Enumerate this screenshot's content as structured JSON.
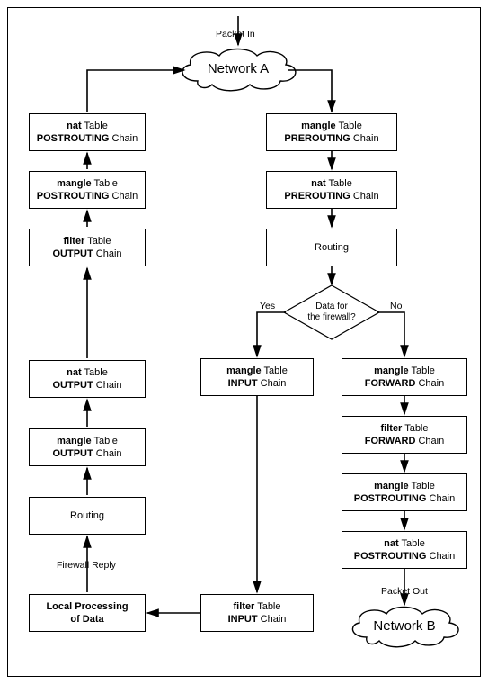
{
  "labels": {
    "packet_in": "Packet In",
    "packet_out": "Packet Out",
    "yes": "Yes",
    "no": "No",
    "firewall_reply": "Firewall Reply"
  },
  "clouds": {
    "network_a": "Network A",
    "network_b": "Network B"
  },
  "decision": {
    "line1": "Data for",
    "line2": "the firewall?"
  },
  "boxes": {
    "mangle_prerouting": {
      "l1": "<b>mangle</b> Table",
      "l2": "<b>PREROUTING</b> Chain"
    },
    "nat_prerouting": {
      "l1": "<b>nat</b> Table",
      "l2": "<b>PREROUTING</b> Chain"
    },
    "routing_r": {
      "l1": "Routing"
    },
    "mangle_input": {
      "l1": "<b>mangle</b> Table",
      "l2": "<b>INPUT</b> Chain"
    },
    "filter_input": {
      "l1": "<b>filter</b> Table",
      "l2": "<b>INPUT</b> Chain"
    },
    "mangle_forward": {
      "l1": "<b>mangle</b> Table",
      "l2": "<b>FORWARD</b> Chain"
    },
    "filter_forward": {
      "l1": "<b>filter</b> Table",
      "l2": "<b>FORWARD</b> Chain"
    },
    "mangle_postrouting_r": {
      "l1": "<b>mangle</b> Table",
      "l2": "<b>POSTROUTING</b> Chain"
    },
    "nat_postrouting_r": {
      "l1": "<b>nat</b> Table",
      "l2": "<b>POSTROUTING</b> Chain"
    },
    "local_processing": {
      "l1": "<b>Local Processing</b>",
      "l2": "<b>of Data</b>"
    },
    "routing_l": {
      "l1": "Routing"
    },
    "mangle_output": {
      "l1": "<b>mangle</b> Table",
      "l2": "<b>OUTPUT</b> Chain"
    },
    "nat_output": {
      "l1": "<b>nat</b> Table",
      "l2": "<b>OUTPUT</b> Chain"
    },
    "filter_output": {
      "l1": "<b>filter</b> Table",
      "l2": "<b>OUTPUT</b> Chain"
    },
    "mangle_postrouting_l": {
      "l1": "<b>mangle</b> Table",
      "l2": "<b>POSTROUTING</b> Chain"
    },
    "nat_postrouting_l": {
      "l1": "<b>nat</b> Table",
      "l2": "<b>POSTROUTING</b> Chain"
    }
  },
  "chart_data": {
    "type": "flowchart",
    "nodes": [
      {
        "id": "network_a",
        "type": "cloud",
        "label": "Network A"
      },
      {
        "id": "mangle_prerouting",
        "type": "process",
        "label": "mangle Table PREROUTING Chain"
      },
      {
        "id": "nat_prerouting",
        "type": "process",
        "label": "nat Table PREROUTING Chain"
      },
      {
        "id": "routing_r",
        "type": "process",
        "label": "Routing"
      },
      {
        "id": "decision",
        "type": "decision",
        "label": "Data for the firewall?"
      },
      {
        "id": "mangle_input",
        "type": "process",
        "label": "mangle Table INPUT Chain"
      },
      {
        "id": "filter_input",
        "type": "process",
        "label": "filter Table INPUT Chain"
      },
      {
        "id": "mangle_forward",
        "type": "process",
        "label": "mangle Table FORWARD Chain"
      },
      {
        "id": "filter_forward",
        "type": "process",
        "label": "filter Table FORWARD Chain"
      },
      {
        "id": "mangle_postrouting_r",
        "type": "process",
        "label": "mangle Table POSTROUTING Chain"
      },
      {
        "id": "nat_postrouting_r",
        "type": "process",
        "label": "nat Table POSTROUTING Chain"
      },
      {
        "id": "network_b",
        "type": "cloud",
        "label": "Network B"
      },
      {
        "id": "local_processing",
        "type": "process",
        "label": "Local Processing of Data"
      },
      {
        "id": "routing_l",
        "type": "process",
        "label": "Routing"
      },
      {
        "id": "mangle_output",
        "type": "process",
        "label": "mangle Table OUTPUT Chain"
      },
      {
        "id": "nat_output",
        "type": "process",
        "label": "nat Table OUTPUT Chain"
      },
      {
        "id": "filter_output",
        "type": "process",
        "label": "filter Table OUTPUT Chain"
      },
      {
        "id": "mangle_postrouting_l",
        "type": "process",
        "label": "mangle Table POSTROUTING Chain"
      },
      {
        "id": "nat_postrouting_l",
        "type": "process",
        "label": "nat Table POSTROUTING Chain"
      }
    ],
    "edges": [
      {
        "from": "packet_in",
        "to": "network_a",
        "label": "Packet In"
      },
      {
        "from": "network_a",
        "to": "mangle_prerouting"
      },
      {
        "from": "mangle_prerouting",
        "to": "nat_prerouting"
      },
      {
        "from": "nat_prerouting",
        "to": "routing_r"
      },
      {
        "from": "routing_r",
        "to": "decision"
      },
      {
        "from": "decision",
        "to": "mangle_input",
        "label": "Yes"
      },
      {
        "from": "decision",
        "to": "mangle_forward",
        "label": "No"
      },
      {
        "from": "mangle_input",
        "to": "filter_input"
      },
      {
        "from": "filter_input",
        "to": "local_processing"
      },
      {
        "from": "local_processing",
        "to": "routing_l",
        "label": "Firewall Reply"
      },
      {
        "from": "routing_l",
        "to": "mangle_output"
      },
      {
        "from": "mangle_output",
        "to": "nat_output"
      },
      {
        "from": "nat_output",
        "to": "filter_output"
      },
      {
        "from": "filter_output",
        "to": "mangle_postrouting_l"
      },
      {
        "from": "mangle_postrouting_l",
        "to": "nat_postrouting_l"
      },
      {
        "from": "nat_postrouting_l",
        "to": "network_a"
      },
      {
        "from": "mangle_forward",
        "to": "filter_forward"
      },
      {
        "from": "filter_forward",
        "to": "mangle_postrouting_r"
      },
      {
        "from": "mangle_postrouting_r",
        "to": "nat_postrouting_r"
      },
      {
        "from": "nat_postrouting_r",
        "to": "network_b",
        "label": "Packet Out"
      }
    ]
  }
}
